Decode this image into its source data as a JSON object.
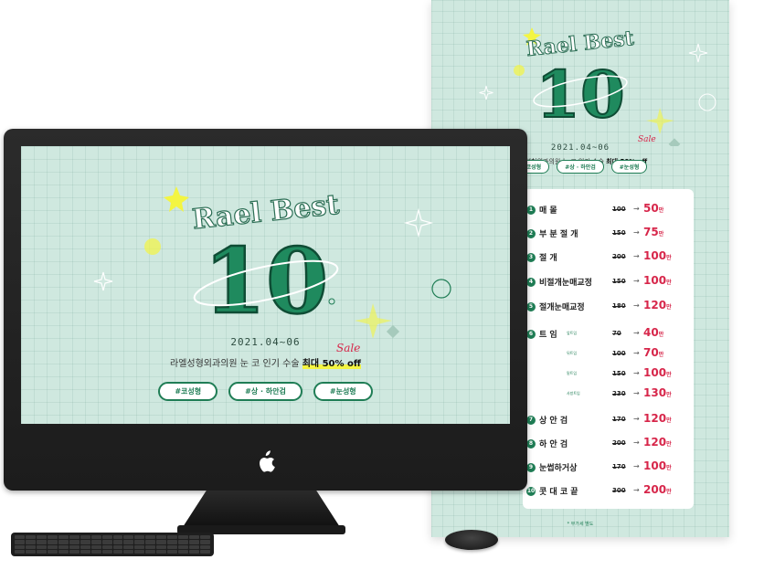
{
  "banner": {
    "title_line1": "Rael Best",
    "title_number": "10",
    "date": "2021.04~06",
    "subtitle_plain": "라엘성형외과의원 눈 코 인기 수술",
    "subtitle_highlight": "최대 50% off",
    "sale_word": "Sale",
    "tags": [
      "#코성형",
      "#상 · 하안검",
      "#눈성형"
    ]
  },
  "poster": {
    "title_line1": "Rael Best",
    "title_number": "10",
    "date": "2021.04~06",
    "subtitle_plain": "라엘성형외과의원 눈 코 인기 수술",
    "subtitle_highlight": "최대 50% off",
    "sale_word": "Sale",
    "tags": [
      "#코성형",
      "#상 · 하안검",
      "#눈성형"
    ],
    "price_list": [
      {
        "num": "1",
        "name": "매 몰",
        "sub": "",
        "old": "100",
        "new": "50",
        "unit": "만"
      },
      {
        "num": "2",
        "name": "부 분 절 개",
        "sub": "",
        "old": "150",
        "new": "75",
        "unit": "만"
      },
      {
        "num": "3",
        "name": "절 개",
        "sub": "",
        "old": "200",
        "new": "100",
        "unit": "만"
      },
      {
        "num": "4",
        "name": "비절개눈매교정",
        "sub": "",
        "old": "150",
        "new": "100",
        "unit": "만"
      },
      {
        "num": "5",
        "name": "절개눈매교정",
        "sub": "",
        "old": "180",
        "new": "120",
        "unit": "만"
      },
      {
        "num": "6",
        "name": "트 임",
        "sub": "앞트임",
        "old": "70",
        "new": "40",
        "unit": "만"
      },
      {
        "num": "",
        "name": "",
        "sub": "뒤트임",
        "old": "100",
        "new": "70",
        "unit": "만"
      },
      {
        "num": "",
        "name": "",
        "sub": "밑트임",
        "old": "150",
        "new": "100",
        "unit": "만"
      },
      {
        "num": "",
        "name": "",
        "sub": "사방트임",
        "old": "230",
        "new": "130",
        "unit": "만"
      },
      {
        "num": "7",
        "name": "상 안 검",
        "sub": "",
        "old": "170",
        "new": "120",
        "unit": "만"
      },
      {
        "num": "8",
        "name": "하 안 검",
        "sub": "",
        "old": "200",
        "new": "120",
        "unit": "만"
      },
      {
        "num": "9",
        "name": "눈썹하거상",
        "sub": "",
        "old": "170",
        "new": "100",
        "unit": "만"
      },
      {
        "num": "10",
        "name": "콧 대 코 끝",
        "sub": "",
        "old": "300",
        "new": "200",
        "unit": "만"
      }
    ],
    "footer_note": "* 부가세 별도"
  },
  "colors": {
    "background": "#cfe8df",
    "accent_green": "#1f7d55",
    "sale_red": "#d7264a",
    "highlight_yellow": "#f3f542"
  }
}
